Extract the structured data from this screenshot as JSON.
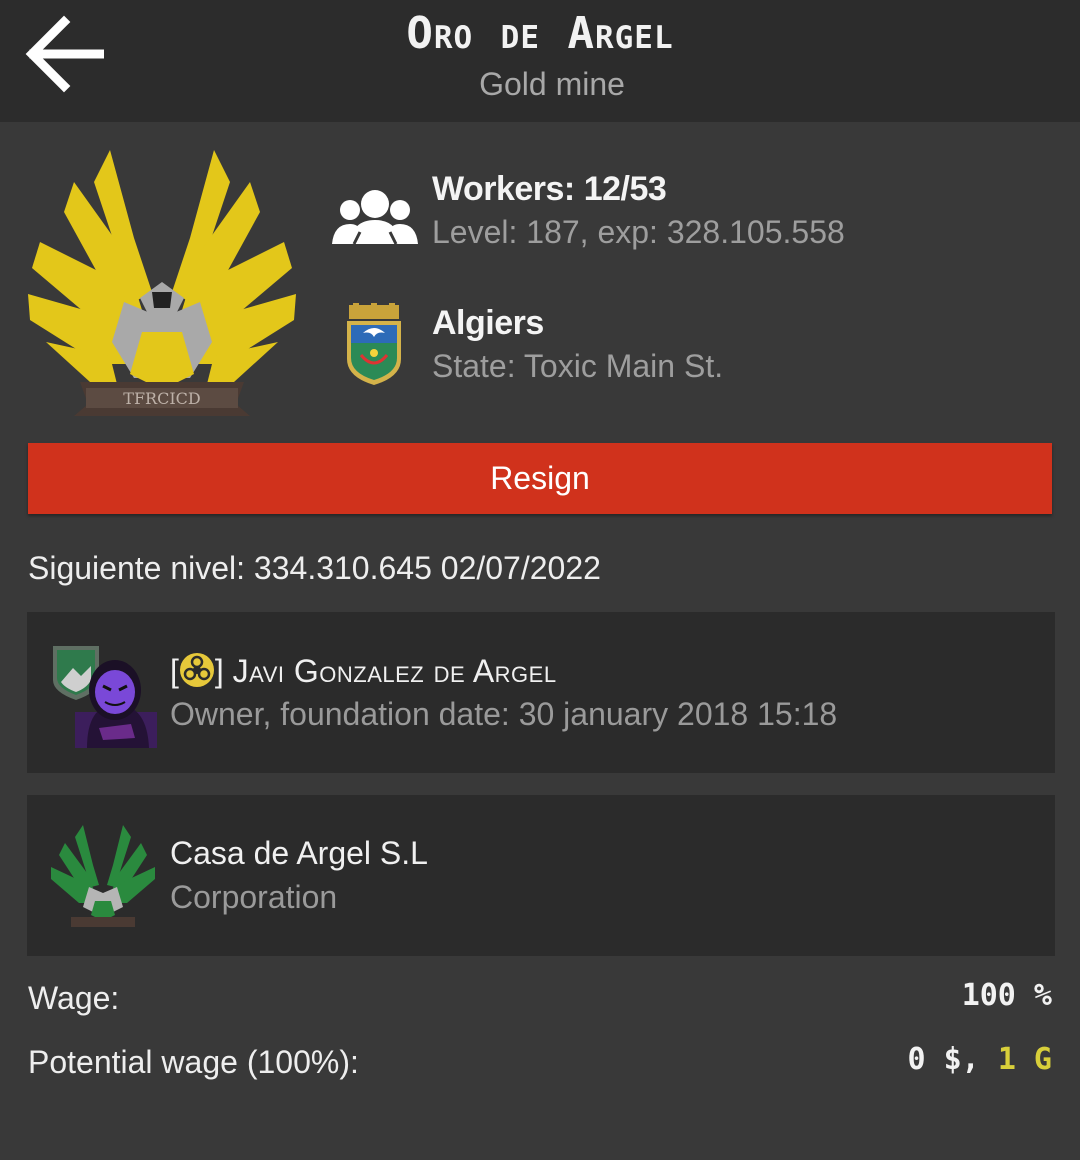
{
  "header": {
    "title": "Oro de Argel",
    "subtitle": "Gold mine"
  },
  "workers": {
    "title": "Workers: 12/53",
    "detail": "Level: 187, exp: 328.105.558",
    "icon": "group-icon"
  },
  "region": {
    "title": "Algiers",
    "detail": "State: Toxic Main St.",
    "icon": "region-coat-of-arms-icon"
  },
  "resign_label": "Resign",
  "next_level": "Siguiente nivel: 334.310.645 02/07/2022",
  "owner": {
    "bracket_open": "[",
    "bracket_close": "]",
    "name": "Javi Gonzalez de Argel",
    "detail": "Owner, foundation date: 30 january 2018 15:18",
    "party_icon": "biohazard-icon"
  },
  "corporation": {
    "name": "Casa de Argel S.L",
    "detail": "Corporation"
  },
  "wage": {
    "label": "Wage:",
    "value": "100 %"
  },
  "potential_wage": {
    "label": "Potential wage (100%):",
    "money": "0 $,",
    "gold": "1 G"
  },
  "colors": {
    "header_bg": "#2c2c2c",
    "page_bg": "#393939",
    "card_bg": "#2b2b2b",
    "resign_bg": "#d0321c",
    "gold": "#d8cf3a"
  }
}
